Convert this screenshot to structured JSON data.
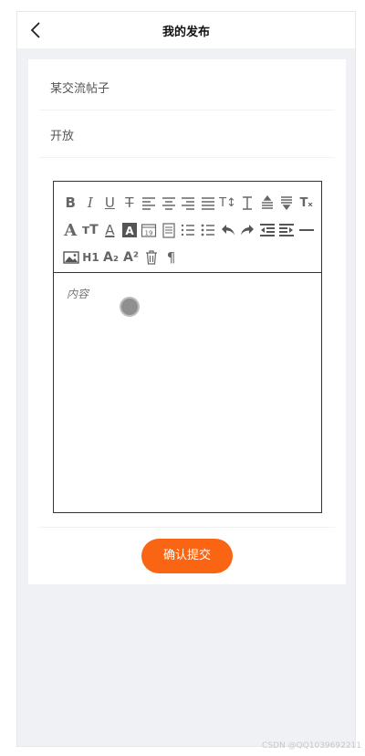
{
  "header": {
    "title": "我的发布",
    "back_icon": "chevron-left-icon"
  },
  "form": {
    "post_type_value": "某交流帖子",
    "visibility_value": "开放"
  },
  "editor": {
    "placeholder": "内容",
    "toolbar_rows": [
      [
        "bold-icon",
        "italic-icon",
        "underline-icon",
        "strikethrough-icon",
        "align-left-icon",
        "align-center-icon",
        "align-right-icon",
        "justify-icon",
        "font-size-icon",
        "line-height-icon",
        "indent-up-icon",
        "indent-down-icon",
        "clear-format-icon"
      ],
      [
        "font-family-icon",
        "text-size-icon",
        "font-color-icon",
        "background-color-icon",
        "date-icon",
        "checklist-icon",
        "ordered-list-icon",
        "bullet-list-icon",
        "undo-icon",
        "redo-icon",
        "outdent-icon",
        "indent-icon",
        "horizontal-rule-icon"
      ],
      [
        "image-icon",
        "heading-icon",
        "subscript-icon",
        "superscript-icon",
        "trash-icon",
        "paragraph-icon"
      ]
    ]
  },
  "actions": {
    "submit_label": "确认提交"
  },
  "watermark": "CSDN @QQ1039692211",
  "colors": {
    "accent": "#fa6514",
    "page_bg": "#f0f1f5"
  }
}
